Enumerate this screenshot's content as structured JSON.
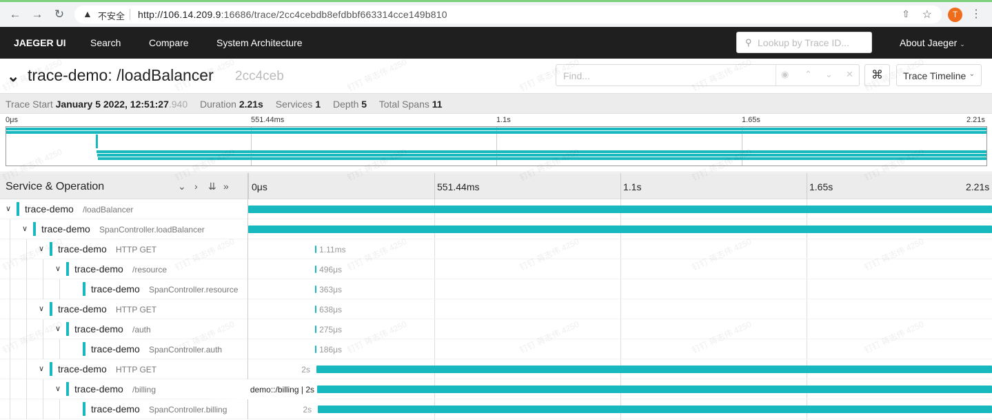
{
  "browser": {
    "security_label": "不安全",
    "url_host": "http://106.14.209.9",
    "url_rest": ":16686/trace/2cc4cebdb8efdbbf663314cce149b810",
    "profile_initial": "T"
  },
  "topnav": {
    "brand": "JAEGER UI",
    "search": "Search",
    "compare": "Compare",
    "system_architecture": "System Architecture",
    "lookup_placeholder": "Lookup by Trace ID...",
    "about": "About Jaeger"
  },
  "trace": {
    "title": "trace-demo: /loadBalancer",
    "short_id": "2cc4ceb",
    "find_placeholder": "Find...",
    "view_select": "Trace Timeline",
    "summary": {
      "start_label": "Trace Start",
      "start_value": "January 5 2022, 12:51:27",
      "start_ms": ".940",
      "duration_label": "Duration",
      "duration_value": "2.21s",
      "services_label": "Services",
      "services_value": "1",
      "depth_label": "Depth",
      "depth_value": "5",
      "spans_label": "Total Spans",
      "spans_value": "11"
    }
  },
  "minimap": {
    "ticks": [
      "0μs",
      "551.44ms",
      "1.1s",
      "1.65s",
      "2.21s"
    ]
  },
  "timeline": {
    "column_title": "Service & Operation",
    "ticks": [
      "0μs",
      "551.44ms",
      "1.1s",
      "1.65s",
      "2.21s"
    ]
  },
  "spans": [
    {
      "service": "trace-demo",
      "operation": "/loadBalancer",
      "depth": 0,
      "has_children": true,
      "start": 0,
      "end": 1.0,
      "duration": ""
    },
    {
      "service": "trace-demo",
      "operation": "SpanController.loadBalancer",
      "depth": 1,
      "has_children": true,
      "start": 0,
      "end": 1.0,
      "duration": ""
    },
    {
      "service": "trace-demo",
      "operation": "HTTP GET",
      "depth": 2,
      "has_children": true,
      "start": 0.09,
      "end": 0.0905,
      "duration": "1.11ms"
    },
    {
      "service": "trace-demo",
      "operation": "/resource",
      "depth": 3,
      "has_children": true,
      "start": 0.09,
      "end": 0.0902,
      "duration": "496μs"
    },
    {
      "service": "trace-demo",
      "operation": "SpanController.resource",
      "depth": 4,
      "has_children": false,
      "start": 0.09,
      "end": 0.0902,
      "duration": "363μs"
    },
    {
      "service": "trace-demo",
      "operation": "HTTP GET",
      "depth": 2,
      "has_children": true,
      "start": 0.09,
      "end": 0.0903,
      "duration": "638μs"
    },
    {
      "service": "trace-demo",
      "operation": "/auth",
      "depth": 3,
      "has_children": true,
      "start": 0.09,
      "end": 0.0901,
      "duration": "275μs"
    },
    {
      "service": "trace-demo",
      "operation": "SpanController.auth",
      "depth": 4,
      "has_children": false,
      "start": 0.09,
      "end": 0.0901,
      "duration": "186μs"
    },
    {
      "service": "trace-demo",
      "operation": "HTTP GET",
      "depth": 2,
      "has_children": true,
      "start": 0.092,
      "end": 1.0,
      "duration": "2s"
    },
    {
      "service": "trace-demo",
      "operation": "/billing",
      "depth": 3,
      "has_children": true,
      "start": 0.093,
      "end": 1.0,
      "duration": "2s",
      "hover_label": "demo::/billing | 2s"
    },
    {
      "service": "trace-demo",
      "operation": "SpanController.billing",
      "depth": 4,
      "has_children": false,
      "start": 0.094,
      "end": 1.0,
      "duration": "2s"
    }
  ],
  "watermark_text": "钉钉 蒋志伟 4250",
  "colors": {
    "span": "#17b8be",
    "nav_bg": "#1f1f1f"
  }
}
